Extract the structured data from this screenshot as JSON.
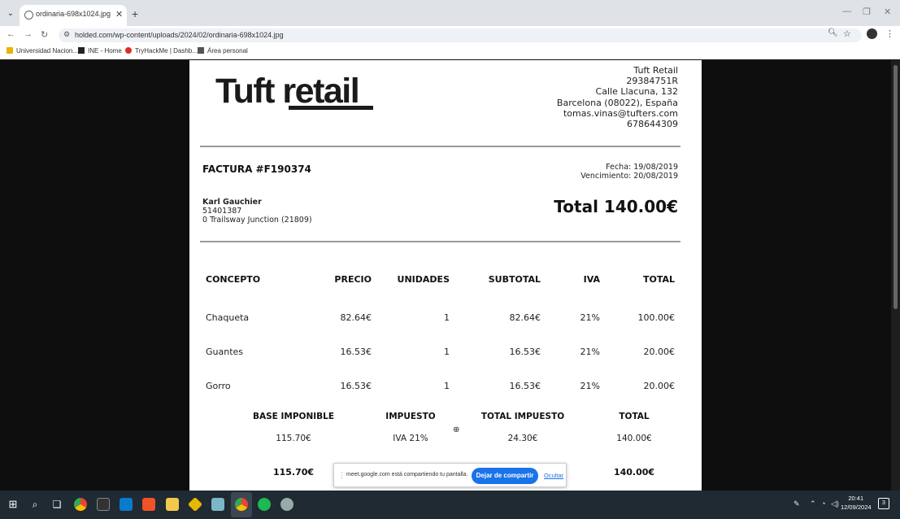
{
  "browser": {
    "tab_title": "ordinaria-698x1024.jpg (698×1",
    "url": "holded.com/wp-content/uploads/2024/02/ordinaria-698x1024.jpg",
    "bookmarks": [
      "Universidad Nacion...",
      "INE - Home",
      "TryHackMe | Dashb...",
      "Área personal"
    ]
  },
  "invoice": {
    "logo_text": "Tuft retail",
    "company": {
      "name": "Tuft Retail",
      "id": "29384751R",
      "street": "Calle Llacuna, 132",
      "city": "Barcelona (08022), España",
      "email": "tomas.vinas@tufters.com",
      "phone": "678644309"
    },
    "number": "FACTURA #F190374",
    "date": "Fecha: 19/08/2019",
    "due": "Vencimiento: 20/08/2019",
    "client": {
      "name": "Karl Gauchier",
      "id": "51401387",
      "address": "0 Trailsway Junction (21809)"
    },
    "grand_total": "Total 140.00€",
    "table": {
      "headers": [
        "CONCEPTO",
        "PRECIO",
        "UNIDADES",
        "SUBTOTAL",
        "IVA",
        "TOTAL"
      ],
      "rows": [
        [
          "Chaqueta",
          "82.64€",
          "1",
          "82.64€",
          "21%",
          "100.00€"
        ],
        [
          "Guantes",
          "16.53€",
          "1",
          "16.53€",
          "21%",
          "20.00€"
        ],
        [
          "Gorro",
          "16.53€",
          "1",
          "16.53€",
          "21%",
          "20.00€"
        ]
      ]
    },
    "summary": {
      "headers": [
        "BASE IMPONIBLE",
        "IMPUESTO",
        "TOTAL IMPUESTO",
        "TOTAL"
      ],
      "values": [
        "115.70€",
        "IVA 21%",
        "24.30€",
        "140.00€"
      ],
      "totals": [
        "115.70€",
        "140.00€"
      ]
    }
  },
  "share_bar": {
    "message": "meet.google.com está compartiendo tu pantalla.",
    "stop_label": "Dejar de compartir",
    "hide_label": "Ocultar"
  },
  "taskbar": {
    "time": "20:41",
    "date": "12/09/2024"
  }
}
